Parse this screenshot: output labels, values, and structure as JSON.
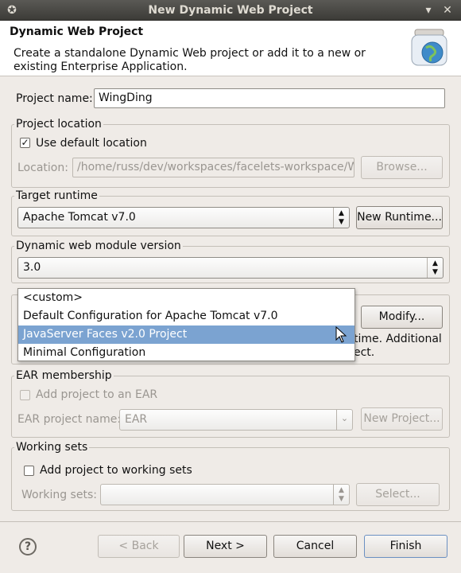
{
  "window": {
    "title": "New Dynamic Web Project"
  },
  "header": {
    "title": "Dynamic Web Project",
    "description": "Create a standalone Dynamic Web project or add it to a new or existing Enterprise Application."
  },
  "project_name": {
    "label": "Project name:",
    "value": "WingDing"
  },
  "project_location": {
    "group_label": "Project location",
    "use_default_label": "Use default location",
    "use_default_checked": true,
    "location_label": "Location:",
    "location_value": "/home/russ/dev/workspaces/facelets-workspace/W",
    "browse_label": "Browse..."
  },
  "target_runtime": {
    "group_label": "Target runtime",
    "value": "Apache Tomcat v7.0",
    "new_runtime_label": "New Runtime..."
  },
  "module_version": {
    "group_label": "Dynamic web module version",
    "value": "3.0"
  },
  "configuration": {
    "modify_label": "Modify...",
    "desc_line1_tail": "time. Additional",
    "desc_line2_tail": "ect.",
    "options": [
      "<custom>",
      "Default Configuration for Apache Tomcat v7.0",
      "JavaServer Faces v2.0 Project",
      "Minimal Configuration"
    ],
    "selected_index": 2
  },
  "ear": {
    "group_label": "EAR membership",
    "add_label": "Add project to an EAR",
    "project_name_label": "EAR project name:",
    "project_name_value": "EAR",
    "new_project_label": "New Project..."
  },
  "working_sets": {
    "group_label": "Working sets",
    "add_label": "Add project to working sets",
    "sets_label": "Working sets:",
    "select_label": "Select..."
  },
  "footer": {
    "back_label": "< Back",
    "next_label": "Next >",
    "cancel_label": "Cancel",
    "finish_label": "Finish"
  }
}
